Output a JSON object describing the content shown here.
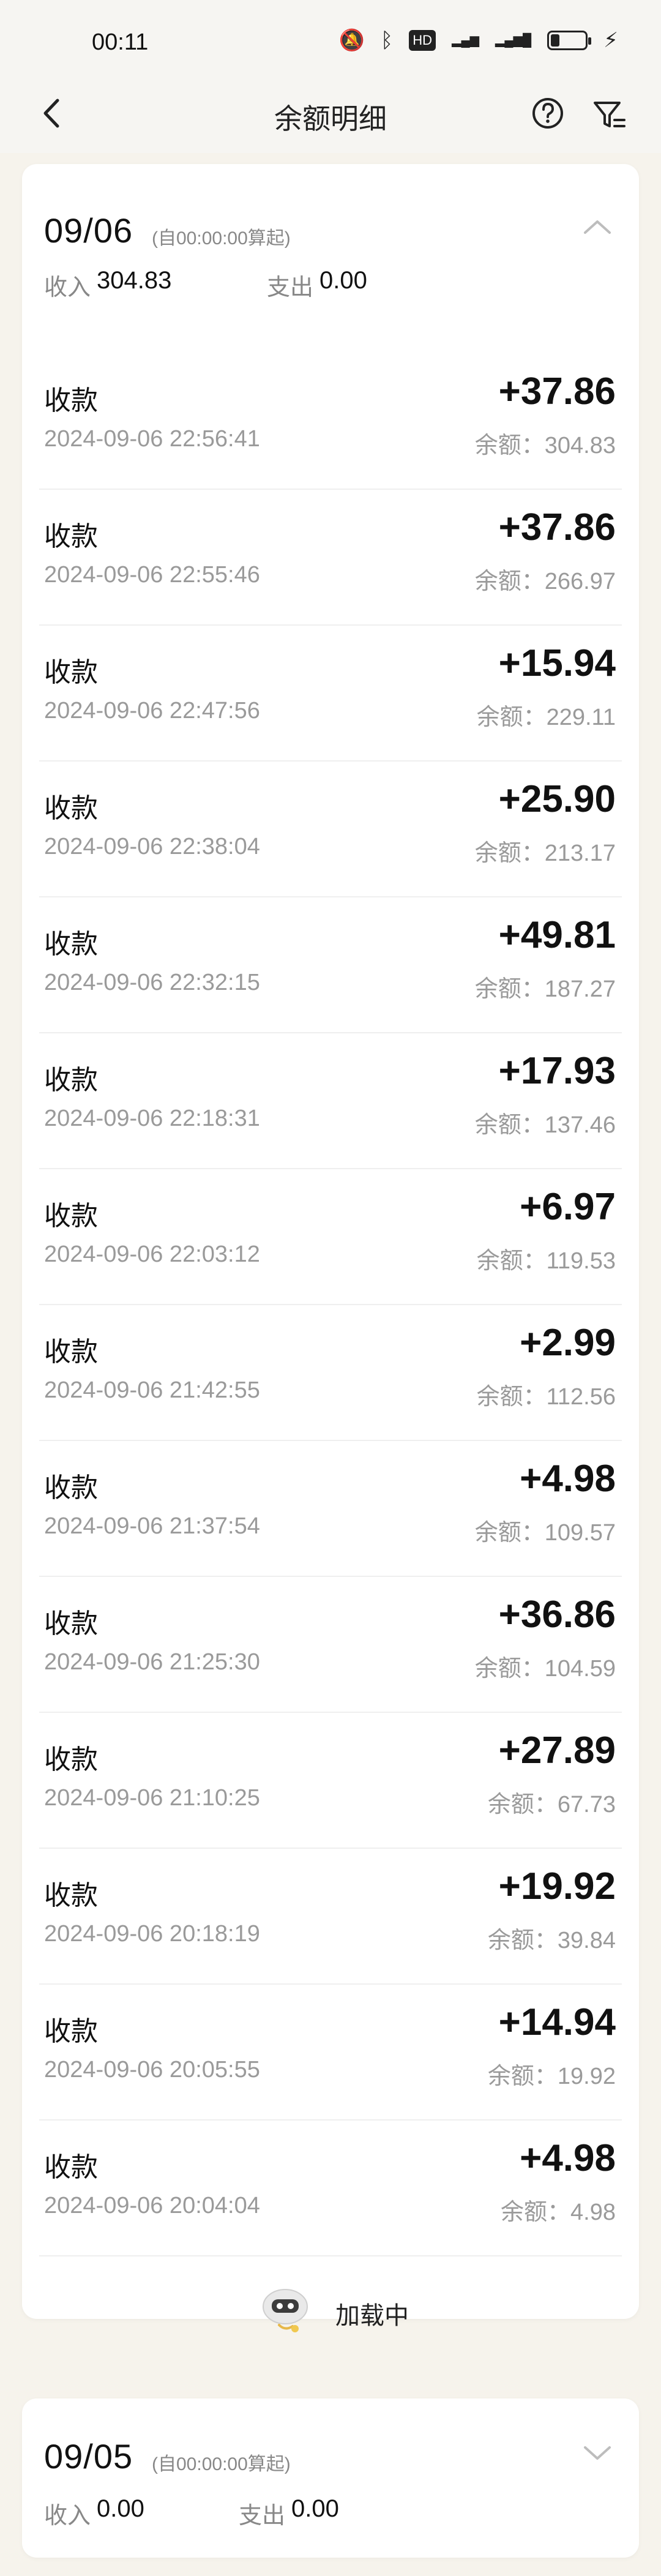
{
  "status_bar": {
    "time": "00:11",
    "icons": [
      "mute-icon",
      "bluetooth-icon",
      "hd-icon",
      "wifi-x-icon",
      "5g-signal-icon",
      "battery-icon",
      "charging-icon"
    ],
    "hd_label": "HD"
  },
  "nav": {
    "title": "余额明细"
  },
  "day1": {
    "date": "09/06",
    "note": "(自00:00:00算起)",
    "income_label": "收入",
    "income_value": "304.83",
    "expense_label": "支出",
    "expense_value": "0.00",
    "transactions": [
      {
        "type": "收款",
        "time": "2024-09-06 22:56:41",
        "amount": "+37.86",
        "balance": "余额：304.83"
      },
      {
        "type": "收款",
        "time": "2024-09-06 22:55:46",
        "amount": "+37.86",
        "balance": "余额：266.97"
      },
      {
        "type": "收款",
        "time": "2024-09-06 22:47:56",
        "amount": "+15.94",
        "balance": "余额：229.11"
      },
      {
        "type": "收款",
        "time": "2024-09-06 22:38:04",
        "amount": "+25.90",
        "balance": "余额：213.17"
      },
      {
        "type": "收款",
        "time": "2024-09-06 22:32:15",
        "amount": "+49.81",
        "balance": "余额：187.27"
      },
      {
        "type": "收款",
        "time": "2024-09-06 22:18:31",
        "amount": "+17.93",
        "balance": "余额：137.46"
      },
      {
        "type": "收款",
        "time": "2024-09-06 22:03:12",
        "amount": "+6.97",
        "balance": "余额：119.53"
      },
      {
        "type": "收款",
        "time": "2024-09-06 21:42:55",
        "amount": "+2.99",
        "balance": "余额：112.56"
      },
      {
        "type": "收款",
        "time": "2024-09-06 21:37:54",
        "amount": "+4.98",
        "balance": "余额：109.57"
      },
      {
        "type": "收款",
        "time": "2024-09-06 21:25:30",
        "amount": "+36.86",
        "balance": "余额：104.59"
      },
      {
        "type": "收款",
        "time": "2024-09-06 21:10:25",
        "amount": "+27.89",
        "balance": "余额：67.73"
      },
      {
        "type": "收款",
        "time": "2024-09-06 20:18:19",
        "amount": "+19.92",
        "balance": "余额：39.84"
      },
      {
        "type": "收款",
        "time": "2024-09-06 20:05:55",
        "amount": "+14.94",
        "balance": "余额：19.92"
      },
      {
        "type": "收款",
        "time": "2024-09-06 20:04:04",
        "amount": "+4.98",
        "balance": "余额：4.98"
      }
    ],
    "loading_text": "加载中"
  },
  "day2": {
    "date": "09/05",
    "note": "(自00:00:00算起)",
    "income_label": "收入",
    "income_value": "0.00",
    "expense_label": "支出",
    "expense_value": "0.00"
  }
}
